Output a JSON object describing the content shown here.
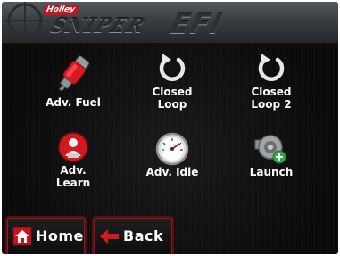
{
  "header": {
    "brand_badge": "Holley",
    "brand_script": "SNIPER",
    "brand_suffix": "EFI"
  },
  "menu": {
    "items": [
      {
        "label": "Adv. Fuel",
        "icon": "fuel-injector-icon"
      },
      {
        "label": "Closed\nLoop",
        "icon": "refresh-icon"
      },
      {
        "label": "Closed\nLoop 2",
        "icon": "refresh-icon"
      },
      {
        "label": "Adv.\nLearn",
        "icon": "learn-icon"
      },
      {
        "label": "Adv. Idle",
        "icon": "gauge-icon"
      },
      {
        "label": "Launch",
        "icon": "turbo-icon"
      }
    ]
  },
  "nav": {
    "home_label": "Home",
    "back_label": "Back"
  },
  "colors": {
    "accent_red": "#c8141c",
    "background": "#0b0b0c",
    "text": "#ffffff"
  }
}
